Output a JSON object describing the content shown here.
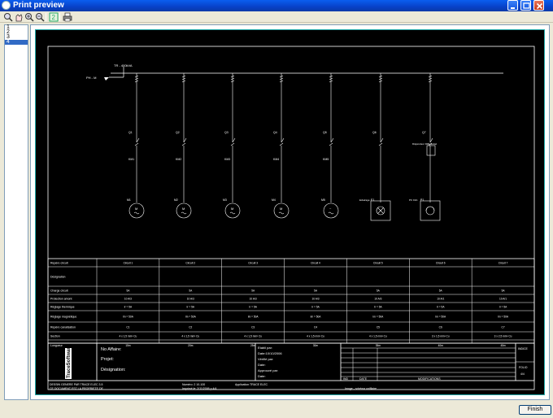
{
  "window": {
    "title": "Print preview"
  },
  "toolbar": {
    "buttons": [
      "zoom-fit-icon",
      "pan-icon",
      "zoom-in-icon",
      "zoom-out-icon",
      "page-setup-icon",
      "print-icon"
    ]
  },
  "pages": {
    "items": [
      "1",
      "2",
      "3",
      "4"
    ],
    "selected": "4"
  },
  "schematic": {
    "supply": {
      "label": "TR - 400kVA",
      "bus_label": "PH - M"
    },
    "circuits": [
      {
        "id": "M1",
        "breaker": "Q1",
        "contactor": "KM1",
        "kind": "motor",
        "load_glyph": "M"
      },
      {
        "id": "M2",
        "breaker": "Q2",
        "contactor": "KM2",
        "kind": "motor",
        "load_glyph": "M"
      },
      {
        "id": "M3",
        "breaker": "Q3",
        "contactor": "KM3",
        "kind": "motor",
        "load_glyph": "M"
      },
      {
        "id": "M4",
        "breaker": "Q4",
        "contactor": "KM4",
        "kind": "motor",
        "load_glyph": "M"
      },
      {
        "id": "M5",
        "breaker": "Q5",
        "contactor": "KM5",
        "kind": "motor",
        "load_glyph": "~"
      },
      {
        "id": "E1",
        "breaker": "Q6",
        "contactor": "",
        "kind": "lighting",
        "load_label": "Eclairage"
      },
      {
        "id": "P1",
        "breaker": "Q7",
        "contactor": "",
        "kind": "socket",
        "load_label": "PC 16A",
        "extra": "Disjoncteur Differentiel"
      }
    ]
  },
  "table": {
    "row_labels": [
      "Repère circuit",
      "Désignation",
      "Charge circuit",
      "Protection amont",
      "Réglage thermique",
      "Réglage magnétique",
      "Repère canalisation",
      "Section",
      "Longueur"
    ],
    "columns": [
      [
        "Circuit 1",
        "",
        "5A",
        "10 A/3",
        "Ir = 5A",
        "Im = 50A",
        "C1",
        "4 x 1,5 mm² Cu",
        "15m"
      ],
      [
        "Circuit 2",
        "",
        "5A",
        "10 A/3",
        "Ir = 5A",
        "Im = 50A",
        "C2",
        "4 x 1,5 mm² Cu",
        "20m"
      ],
      [
        "Circuit 3",
        "",
        "5A",
        "10 A/3",
        "Ir = 5A",
        "Im = 50A",
        "C3",
        "4 x 1,5 mm² Cu",
        "25m"
      ],
      [
        "Circuit 4",
        "",
        "5A",
        "10 A/3",
        "Ir = 5A",
        "Im = 50A",
        "C4",
        "4 x 1,5 mm² Cu",
        "30m"
      ],
      [
        "Circuit 5",
        "",
        "5A",
        "10 A/3",
        "Ir = 5A",
        "Im = 50A",
        "C5",
        "4 x 1,5 mm² Cu",
        "35m"
      ],
      [
        "Circuit 6",
        "",
        "5A",
        "10 A/1",
        "Ir = 5A",
        "Im = 50A",
        "C6",
        "3 x 1,5 mm² Cu",
        "40m"
      ],
      [
        "Circuit 7",
        "",
        "5A",
        "10 A/1",
        "Ir = 5A",
        "Im = 50A",
        "C7",
        "3 x 2,5 mm² Cu",
        "45m"
      ]
    ]
  },
  "title_block": {
    "brand": "TraceSoftware",
    "affaire_label": "No Affaire:",
    "projet_label": "Projet:",
    "designation_label": "Désignation:",
    "etabli_label": "Etabli par:",
    "date_label": "Date:10/10/2006",
    "verifie_label": "Vérifié par:",
    "date2_label": "Date:",
    "approuve_label": "Approuvé par:",
    "date3_label": "Date:",
    "ind_label": "IND",
    "date_col_label": "DATE",
    "modif_label": "MODIFICATIONS",
    "indice_label": "INDICE",
    "folio_label": "FOLIO",
    "folio_value": "4/4",
    "footer_line1": "DESSIN GENERE PAR TRACE ELEC 3.5",
    "footer_line2": "CE DOCUMENT EST LA PROPRIETE DE",
    "footer_mid1": "Numéro: 2 10-100",
    "footer_mid2": "Imprimé le: 2/11/2006 p 4/4",
    "footer_right1": "Application:TRACE ELEC",
    "footer_right2": "Image - schéma unifilaire"
  },
  "footer": {
    "finish_label": "Finish"
  },
  "colors": {
    "titlebar": "#0841c8",
    "sheet_bg": "#000000",
    "sheet_ink": "#ffffff",
    "selection": "#316ac5"
  }
}
